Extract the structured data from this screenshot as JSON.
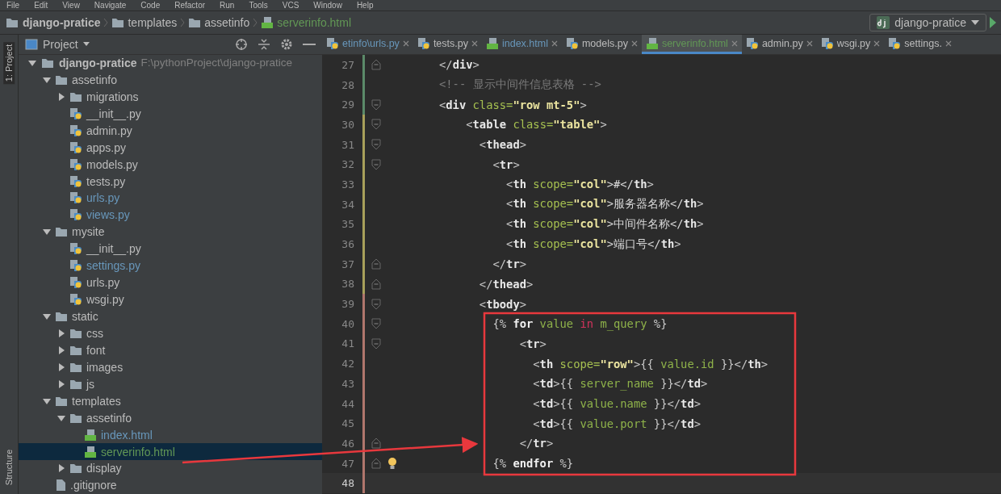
{
  "menu": [
    "File",
    "Edit",
    "View",
    "Navigate",
    "Code",
    "Refactor",
    "Run",
    "Tools",
    "VCS",
    "Window",
    "Help"
  ],
  "breadcrumb": [
    {
      "label": "django-pratice",
      "kind": "root"
    },
    {
      "label": "templates",
      "kind": "folder"
    },
    {
      "label": "assetinfo",
      "kind": "folder"
    },
    {
      "label": "serverinfo.html",
      "kind": "html"
    }
  ],
  "run_config": {
    "label": "django-pratice"
  },
  "side_strip": {
    "top": "1: Project",
    "bottom": "Structure"
  },
  "project_panel": {
    "title": "Project",
    "tree": [
      {
        "name": "django-pratice",
        "path": "F:\\pythonProject\\django-pratice",
        "kind": "root",
        "expanded": true,
        "selected": false,
        "color": "#bbbbbb",
        "children": [
          {
            "name": "assetinfo",
            "kind": "folder",
            "expanded": true,
            "selected": false,
            "color": "#bbbbbb",
            "children": [
              {
                "name": "migrations",
                "kind": "folder",
                "expanded": false,
                "selected": false,
                "color": "#bbbbbb"
              },
              {
                "name": "__init__.py",
                "kind": "python",
                "selected": false,
                "color": "#bbbbbb"
              },
              {
                "name": "admin.py",
                "kind": "python",
                "selected": false,
                "color": "#bbbbbb"
              },
              {
                "name": "apps.py",
                "kind": "python",
                "selected": false,
                "color": "#bbbbbb"
              },
              {
                "name": "models.py",
                "kind": "python",
                "selected": false,
                "color": "#bbbbbb"
              },
              {
                "name": "tests.py",
                "kind": "python",
                "selected": false,
                "color": "#bbbbbb"
              },
              {
                "name": "urls.py",
                "kind": "python",
                "selected": false,
                "color": "#6897bb"
              },
              {
                "name": "views.py",
                "kind": "python",
                "selected": false,
                "color": "#6897bb"
              }
            ]
          },
          {
            "name": "mysite",
            "kind": "folder",
            "expanded": true,
            "selected": false,
            "color": "#bbbbbb",
            "children": [
              {
                "name": "__init__.py",
                "kind": "python",
                "selected": false,
                "color": "#bbbbbb"
              },
              {
                "name": "settings.py",
                "kind": "python",
                "selected": false,
                "color": "#6897bb"
              },
              {
                "name": "urls.py",
                "kind": "python",
                "selected": false,
                "color": "#bbbbbb"
              },
              {
                "name": "wsgi.py",
                "kind": "python",
                "selected": false,
                "color": "#bbbbbb"
              }
            ]
          },
          {
            "name": "static",
            "kind": "folder",
            "expanded": true,
            "selected": false,
            "color": "#bbbbbb",
            "children": [
              {
                "name": "css",
                "kind": "folder",
                "expanded": false,
                "selected": false,
                "color": "#bbbbbb"
              },
              {
                "name": "font",
                "kind": "folder",
                "expanded": false,
                "selected": false,
                "color": "#bbbbbb"
              },
              {
                "name": "images",
                "kind": "folder",
                "expanded": false,
                "selected": false,
                "color": "#bbbbbb"
              },
              {
                "name": "js",
                "kind": "folder",
                "expanded": false,
                "selected": false,
                "color": "#bbbbbb"
              }
            ]
          },
          {
            "name": "templates",
            "kind": "folder",
            "expanded": true,
            "selected": false,
            "color": "#bbbbbb",
            "children": [
              {
                "name": "assetinfo",
                "kind": "folder",
                "expanded": true,
                "selected": false,
                "color": "#bbbbbb",
                "children": [
                  {
                    "name": "index.html",
                    "kind": "html",
                    "selected": false,
                    "color": "#6897bb"
                  },
                  {
                    "name": "serverinfo.html",
                    "kind": "html",
                    "selected": true,
                    "color": "#629755"
                  }
                ]
              },
              {
                "name": "display",
                "kind": "folder",
                "expanded": false,
                "selected": false,
                "color": "#bbbbbb"
              }
            ]
          },
          {
            "name": ".gitignore",
            "kind": "file",
            "selected": false,
            "color": "#bbbbbb"
          }
        ]
      }
    ]
  },
  "tabs": [
    {
      "label": "etinfo\\urls.py",
      "kind": "python",
      "color": "#6897bb",
      "selected": false
    },
    {
      "label": "tests.py",
      "kind": "python",
      "color": "#bbbbbb",
      "selected": false
    },
    {
      "label": "index.html",
      "kind": "html",
      "color": "#6897bb",
      "selected": false
    },
    {
      "label": "models.py",
      "kind": "python",
      "color": "#bbbbbb",
      "selected": false
    },
    {
      "label": "serverinfo.html",
      "kind": "html",
      "color": "#629755",
      "selected": true
    },
    {
      "label": "admin.py",
      "kind": "python",
      "color": "#bbbbbb",
      "selected": false
    },
    {
      "label": "wsgi.py",
      "kind": "python",
      "color": "#bbbbbb",
      "selected": false
    },
    {
      "label": "settings.",
      "kind": "python",
      "color": "#bbbbbb",
      "selected": false
    }
  ],
  "editor": {
    "lines": [
      {
        "number": "27",
        "fold_end": true,
        "color": "#5b8a69",
        "current": false,
        "tokens": [
          {
            "kind": "punct",
            "text": "</"
          },
          {
            "kind": "tag",
            "text": "div"
          },
          {
            "kind": "punct",
            "text": ">"
          }
        ]
      },
      {
        "number": "28",
        "color": "#5b8a69",
        "current": false,
        "tokens": [
          {
            "kind": "comment",
            "text": "<!-- 显示中间件信息表格 -->"
          }
        ]
      },
      {
        "number": "29",
        "fold_start": true,
        "color": "#5b8a69",
        "current": false,
        "tokens": [
          {
            "kind": "punct",
            "text": "<"
          },
          {
            "kind": "tag",
            "text": "div"
          },
          {
            "kind": "attr",
            "text": " class="
          },
          {
            "kind": "str",
            "text": "\"row mt-5\""
          },
          {
            "kind": "punct",
            "text": ">"
          }
        ]
      },
      {
        "number": "30",
        "fold_start": true,
        "color": "#a8a05a",
        "current": false,
        "tokens": [
          {
            "kind": "punct",
            "text": "    <"
          },
          {
            "kind": "tag",
            "text": "table"
          },
          {
            "kind": "attr",
            "text": " class="
          },
          {
            "kind": "str",
            "text": "\"table\""
          },
          {
            "kind": "punct",
            "text": ">"
          }
        ]
      },
      {
        "number": "31",
        "fold_start": true,
        "color": "#a8a05a",
        "current": false,
        "tokens": [
          {
            "kind": "punct",
            "text": "      <"
          },
          {
            "kind": "tag",
            "text": "thead"
          },
          {
            "kind": "punct",
            "text": ">"
          }
        ]
      },
      {
        "number": "32",
        "fold_start": true,
        "color": "#a8a05a",
        "current": false,
        "tokens": [
          {
            "kind": "punct",
            "text": "        <"
          },
          {
            "kind": "tag",
            "text": "tr"
          },
          {
            "kind": "punct",
            "text": ">"
          }
        ]
      },
      {
        "number": "33",
        "color": "#a8a05a",
        "current": false,
        "tokens": [
          {
            "kind": "punct",
            "text": "          <"
          },
          {
            "kind": "tag",
            "text": "th"
          },
          {
            "kind": "attr",
            "text": " scope="
          },
          {
            "kind": "str",
            "text": "\"col\""
          },
          {
            "kind": "text",
            "text": ">#</"
          },
          {
            "kind": "tag",
            "text": "th"
          },
          {
            "kind": "punct",
            "text": ">"
          }
        ]
      },
      {
        "number": "34",
        "color": "#a8a05a",
        "current": false,
        "tokens": [
          {
            "kind": "punct",
            "text": "          <"
          },
          {
            "kind": "tag",
            "text": "th"
          },
          {
            "kind": "attr",
            "text": " scope="
          },
          {
            "kind": "str",
            "text": "\"col\""
          },
          {
            "kind": "text",
            "text": ">服务器名称</"
          },
          {
            "kind": "tag",
            "text": "th"
          },
          {
            "kind": "punct",
            "text": ">"
          }
        ]
      },
      {
        "number": "35",
        "color": "#a8a05a",
        "current": false,
        "tokens": [
          {
            "kind": "punct",
            "text": "          <"
          },
          {
            "kind": "tag",
            "text": "th"
          },
          {
            "kind": "attr",
            "text": " scope="
          },
          {
            "kind": "str",
            "text": "\"col\""
          },
          {
            "kind": "text",
            "text": ">中间件名称</"
          },
          {
            "kind": "tag",
            "text": "th"
          },
          {
            "kind": "punct",
            "text": ">"
          }
        ]
      },
      {
        "number": "36",
        "color": "#a8a05a",
        "current": false,
        "tokens": [
          {
            "kind": "punct",
            "text": "          <"
          },
          {
            "kind": "tag",
            "text": "th"
          },
          {
            "kind": "attr",
            "text": " scope="
          },
          {
            "kind": "str",
            "text": "\"col\""
          },
          {
            "kind": "text",
            "text": ">端口号</"
          },
          {
            "kind": "tag",
            "text": "th"
          },
          {
            "kind": "punct",
            "text": ">"
          }
        ]
      },
      {
        "number": "37",
        "fold_end": true,
        "color": "#a8a05a",
        "current": false,
        "tokens": [
          {
            "kind": "punct",
            "text": "        </"
          },
          {
            "kind": "tag",
            "text": "tr"
          },
          {
            "kind": "punct",
            "text": ">"
          }
        ]
      },
      {
        "number": "38",
        "fold_end": true,
        "color": "#a8a05a",
        "current": false,
        "tokens": [
          {
            "kind": "punct",
            "text": "      </"
          },
          {
            "kind": "tag",
            "text": "thead"
          },
          {
            "kind": "punct",
            "text": ">"
          }
        ]
      },
      {
        "number": "39",
        "fold_start": true,
        "color": "#b0766c",
        "current": false,
        "tokens": [
          {
            "kind": "punct",
            "text": "      <"
          },
          {
            "kind": "tag",
            "text": "tbody"
          },
          {
            "kind": "punct",
            "text": ">"
          }
        ]
      },
      {
        "number": "40",
        "fold_start": true,
        "color": "#b0766c",
        "current": false,
        "tokens": [
          {
            "kind": "tmpl",
            "text": "        {% "
          },
          {
            "kind": "tkw",
            "text": "for"
          },
          {
            "kind": "tvar",
            "text": " value "
          },
          {
            "kind": "top",
            "text": "in"
          },
          {
            "kind": "tvar",
            "text": " m_query"
          },
          {
            "kind": "tmpl",
            "text": " %}"
          }
        ]
      },
      {
        "number": "41",
        "fold_start": true,
        "color": "#b0766c",
        "current": false,
        "tokens": [
          {
            "kind": "punct",
            "text": "            <"
          },
          {
            "kind": "tag",
            "text": "tr"
          },
          {
            "kind": "punct",
            "text": ">"
          }
        ]
      },
      {
        "number": "42",
        "color": "#b0766c",
        "current": false,
        "tokens": [
          {
            "kind": "punct",
            "text": "              <"
          },
          {
            "kind": "tag",
            "text": "th"
          },
          {
            "kind": "attr",
            "text": " scope="
          },
          {
            "kind": "str",
            "text": "\"row\""
          },
          {
            "kind": "punct",
            "text": ">"
          },
          {
            "kind": "tmpl",
            "text": "{{"
          },
          {
            "kind": "tvar",
            "text": " value.id "
          },
          {
            "kind": "tmpl",
            "text": "}}"
          },
          {
            "kind": "punct",
            "text": "</"
          },
          {
            "kind": "tag",
            "text": "th"
          },
          {
            "kind": "punct",
            "text": ">"
          }
        ]
      },
      {
        "number": "43",
        "color": "#b0766c",
        "current": false,
        "tokens": [
          {
            "kind": "punct",
            "text": "              <"
          },
          {
            "kind": "tag",
            "text": "td"
          },
          {
            "kind": "punct",
            "text": ">"
          },
          {
            "kind": "tmpl",
            "text": "{{"
          },
          {
            "kind": "tvar",
            "text": " server_name "
          },
          {
            "kind": "tmpl",
            "text": "}}"
          },
          {
            "kind": "punct",
            "text": "</"
          },
          {
            "kind": "tag",
            "text": "td"
          },
          {
            "kind": "punct",
            "text": ">"
          }
        ]
      },
      {
        "number": "44",
        "color": "#b0766c",
        "current": false,
        "tokens": [
          {
            "kind": "punct",
            "text": "              <"
          },
          {
            "kind": "tag",
            "text": "td"
          },
          {
            "kind": "punct",
            "text": ">"
          },
          {
            "kind": "tmpl",
            "text": "{{"
          },
          {
            "kind": "tvar",
            "text": " value.name "
          },
          {
            "kind": "tmpl",
            "text": "}}"
          },
          {
            "kind": "punct",
            "text": "</"
          },
          {
            "kind": "tag",
            "text": "td"
          },
          {
            "kind": "punct",
            "text": ">"
          }
        ]
      },
      {
        "number": "45",
        "color": "#b0766c",
        "current": false,
        "tokens": [
          {
            "kind": "punct",
            "text": "              <"
          },
          {
            "kind": "tag",
            "text": "td"
          },
          {
            "kind": "punct",
            "text": ">"
          },
          {
            "kind": "tmpl",
            "text": "{{"
          },
          {
            "kind": "tvar",
            "text": " value.port "
          },
          {
            "kind": "tmpl",
            "text": "}}"
          },
          {
            "kind": "punct",
            "text": "</"
          },
          {
            "kind": "tag",
            "text": "td"
          },
          {
            "kind": "punct",
            "text": ">"
          }
        ]
      },
      {
        "number": "46",
        "fold_end": true,
        "color": "#b0766c",
        "current": false,
        "tokens": [
          {
            "kind": "punct",
            "text": "            </"
          },
          {
            "kind": "tag",
            "text": "tr"
          },
          {
            "kind": "punct",
            "text": ">"
          }
        ]
      },
      {
        "number": "47",
        "fold_end": true,
        "color": "#b0766c",
        "current": false,
        "hint": true,
        "tokens": [
          {
            "kind": "tmpl",
            "text": "        {% "
          },
          {
            "kind": "tkw",
            "text": "endfor"
          },
          {
            "kind": "tmpl",
            "text": " %}"
          }
        ]
      },
      {
        "number": "48",
        "color": "#b0766c",
        "current": true
      }
    ]
  }
}
